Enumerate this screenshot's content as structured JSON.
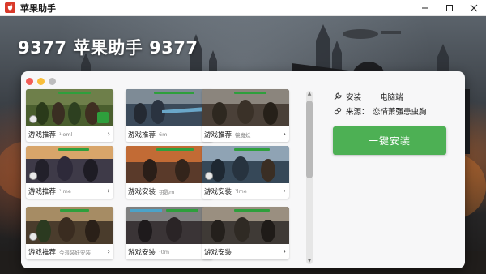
{
  "window": {
    "title": "苹果助手",
    "icon": "apple-app-icon",
    "controls": [
      "minimize-icon",
      "maximize-icon",
      "close-icon"
    ]
  },
  "header": {
    "title": "9377 苹果助手 9377"
  },
  "panel": {
    "cards": [
      {
        "label": "游戏推荐",
        "sub": "¹ioml"
      },
      {
        "label": "游戏推荐",
        "sub": "6m"
      },
      {
        "label": "游戏推荐",
        "sub": "镜魔妖"
      },
      {
        "label": "游戏推荐",
        "sub": "¹Ime"
      },
      {
        "label": "游戏安装",
        "sub": "钥匙m"
      },
      {
        "label": "游戏安装",
        "sub": "¹lme"
      },
      {
        "label": "游戏推荐",
        "sub": "今派装妖安装"
      },
      {
        "label": "游戏安装",
        "sub": "¹0m"
      },
      {
        "label": "游戏安装",
        "sub": ""
      }
    ],
    "info": {
      "install_key": "安装",
      "install_value": "电脑端",
      "source_key": "来源：",
      "source_value": "恋情萧强患虫胸"
    },
    "install_button": "一键安装"
  },
  "colors": {
    "accent_green": "#4db054",
    "window_icon_red": "#d93a2b"
  }
}
